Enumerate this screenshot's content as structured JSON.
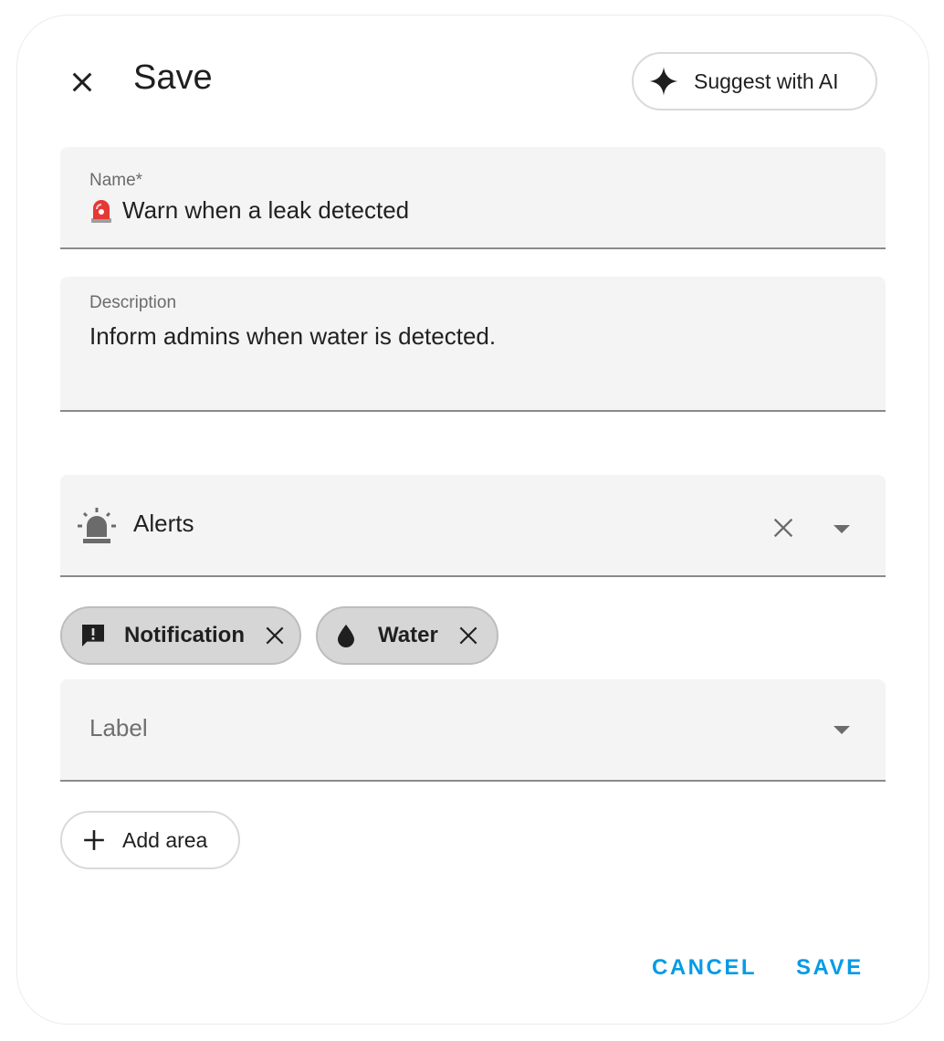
{
  "dialog": {
    "title": "Save",
    "suggest_label": "Suggest with AI"
  },
  "name_field": {
    "label": "Name*",
    "value": "Warn when a leak detected",
    "emoji_icon": "rotating-light-icon"
  },
  "description_field": {
    "label": "Description",
    "value": "Inform admins when water is detected."
  },
  "category": {
    "value": "Alerts",
    "icon": "alarm-light-icon"
  },
  "labels": {
    "chips": [
      {
        "label": "Notification",
        "icon": "message-alert-icon"
      },
      {
        "label": "Water",
        "icon": "water-drop-icon"
      }
    ],
    "placeholder": "Label"
  },
  "area": {
    "add_label": "Add area"
  },
  "actions": {
    "cancel": "CANCEL",
    "save": "SAVE"
  },
  "colors": {
    "accent": "#039be5",
    "field_bg": "#f4f4f4",
    "chip_bg": "#d6d6d6"
  }
}
